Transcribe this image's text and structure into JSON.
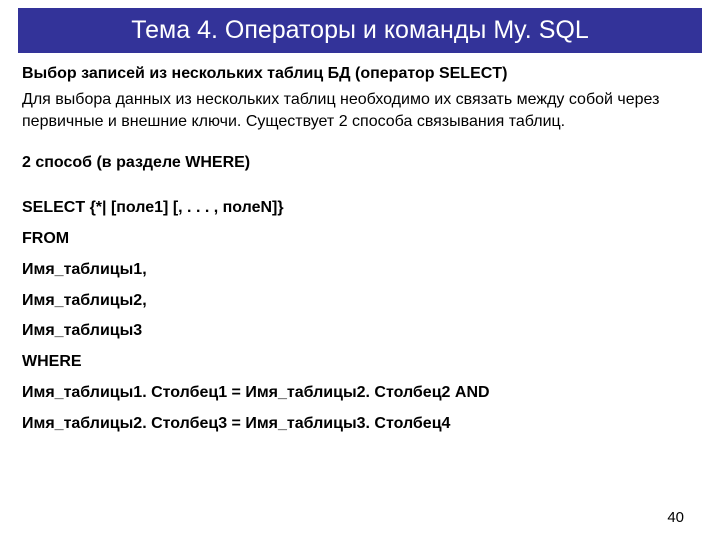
{
  "title": "Тема 4. Операторы и команды My. SQL",
  "section_heading": "Выбор записей из нескольких таблиц БД (оператор SELECT)",
  "description": "Для выбора данных из нескольких таблиц необходимо их связать между собой через первичные и внешние ключи. Существует 2 способа связывания таблиц.",
  "method_label": "2 способ (в разделе WHERE)",
  "code_lines": [
    "SELECT {*| [поле1] [, . . . , полеN]}",
    "FROM",
    "Имя_таблицы1,",
    "Имя_таблицы2,",
    "Имя_таблицы3",
    "WHERE",
    "Имя_таблицы1. Столбец1 = Имя_таблицы2. Столбец2 AND",
    "Имя_таблицы2. Столбец3 = Имя_таблицы3. Столбец4"
  ],
  "page_number": "40"
}
